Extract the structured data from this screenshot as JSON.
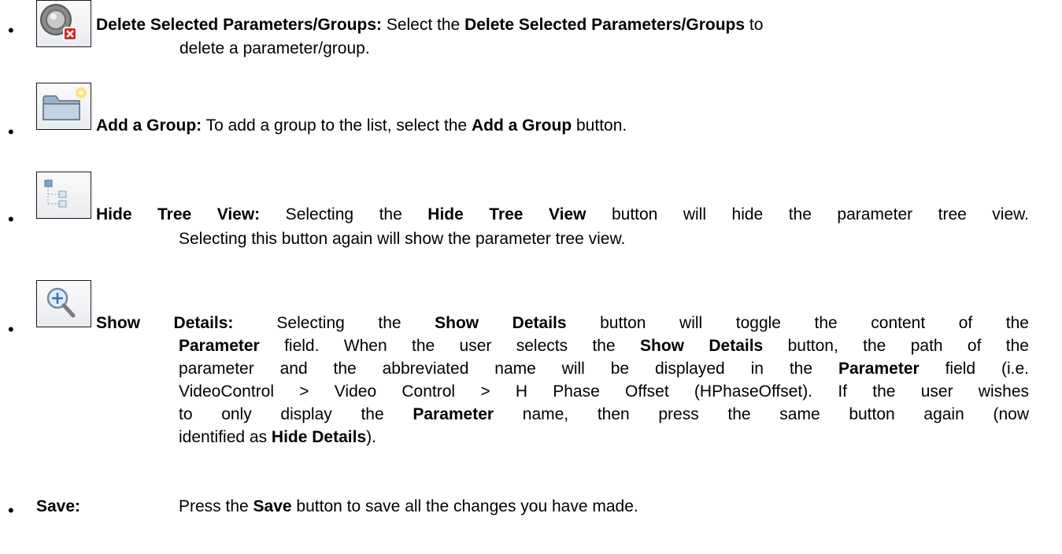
{
  "items": [
    {
      "term": "Delete Selected Parameters/Groups:",
      "line1_a": " Select the ",
      "line1_b": "Delete Selected Parameters/Groups",
      "line1_c": " to",
      "line2": "delete a parameter/group.",
      "icon": "delete-parameters-icon"
    },
    {
      "term": "Add a Group:",
      "line1_a": " To add a group to the list, select the ",
      "line1_b": "Add a Group",
      "line1_c": " button.",
      "icon": "add-group-folder-icon"
    },
    {
      "term": "Hide Tree View:",
      "line1_a": " Selecting the ",
      "line1_b": "Hide Tree View",
      "line1_c": " button will hide the parameter tree view.",
      "line2": "Selecting this button again will show the parameter tree view.",
      "icon": "tree-view-icon"
    },
    {
      "term": "Show Details:",
      "line1_a": "Selecting the ",
      "line1_b": "Show Details",
      "line1_c": " button will toggle the content of the",
      "l2_b1": "Parameter",
      "l2_a": " field.  When the user selects the ",
      "l2_b2": "Show Details",
      "l2_c": " button, the path of the",
      "l3_a": "parameter and the abbreviated name will be displayed in the ",
      "l3_b": "Parameter",
      "l3_c": " field (i.e.",
      "l4": "VideoControl > Video Control > H Phase Offset (HPhaseOffset).  If the user wishes",
      "l5_a": "to only display the ",
      "l5_b": "Parameter",
      "l5_c": " name, then press the same button again (now",
      "l6_a": "identified as ",
      "l6_b": "Hide Details",
      "l6_c": ").",
      "icon": "magnifier-plus-icon"
    },
    {
      "term": "Save:",
      "line1_a": "Press the ",
      "line1_b": "Save",
      "line1_c": " button to save all the changes you have made."
    }
  ],
  "bullet": "•"
}
